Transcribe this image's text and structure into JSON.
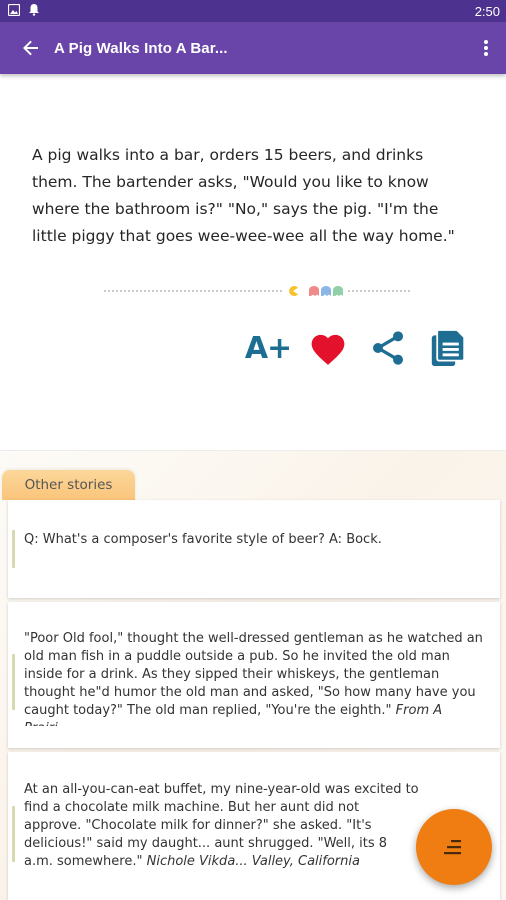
{
  "status_bar": {
    "time": "2:50",
    "icons": [
      "image-icon",
      "notification-bell-icon"
    ]
  },
  "app_bar": {
    "title": "A Pig Walks Into A Bar...",
    "back_icon": "arrow-back-icon",
    "menu_icon": "more-vert-icon"
  },
  "joke": {
    "text": "A pig walks into a bar, orders 15 beers, and drinks them. The bartender asks, \"Would you like to know where the bathroom is?\" \"No,\" says the pig. \"I'm the little piggy that goes wee-wee-wee all the way home.\""
  },
  "actions": {
    "font_size_label": "A+",
    "icons": [
      "font-increase-icon",
      "heart-icon",
      "share-icon",
      "copy-icon"
    ],
    "colors": {
      "primary": "#1d6e92",
      "heart": "#e4112d"
    }
  },
  "other_stories": {
    "tab_label": "Other stories",
    "stories": [
      {
        "text": "Q: What's a composer's favorite style of beer? A: Bock.",
        "source": ""
      },
      {
        "text": "\"Poor Old fool,\" thought the well-dressed gentleman as he watched an old man fish in a puddle outside a pub. So he invited the old man inside for a drink. As they sipped their whiskeys, the gentleman thought he\"d humor the old man and asked, \"So how many have you caught today?\" The old man replied, \"You're the eighth.\"",
        "source": "From A Prairi..."
      },
      {
        "text": "At an all-you-can-eat buffet, my nine-year-old was excited to find a chocolate milk machine. But her aunt did not approve. \"Chocolate milk for dinner?\" she asked. \"It's delicious!\" said my daught... aunt shrugged. \"Well, its 8 a.m. somewhere.\"",
        "source": "Nichole Vikda... Valley, California"
      }
    ]
  },
  "fab": {
    "icon": "sort-menu-icon",
    "color": "#ef7d12"
  },
  "theme": {
    "status_bar": "#4e3290",
    "app_bar": "#6a45a9",
    "tab": "#f9c47a"
  }
}
